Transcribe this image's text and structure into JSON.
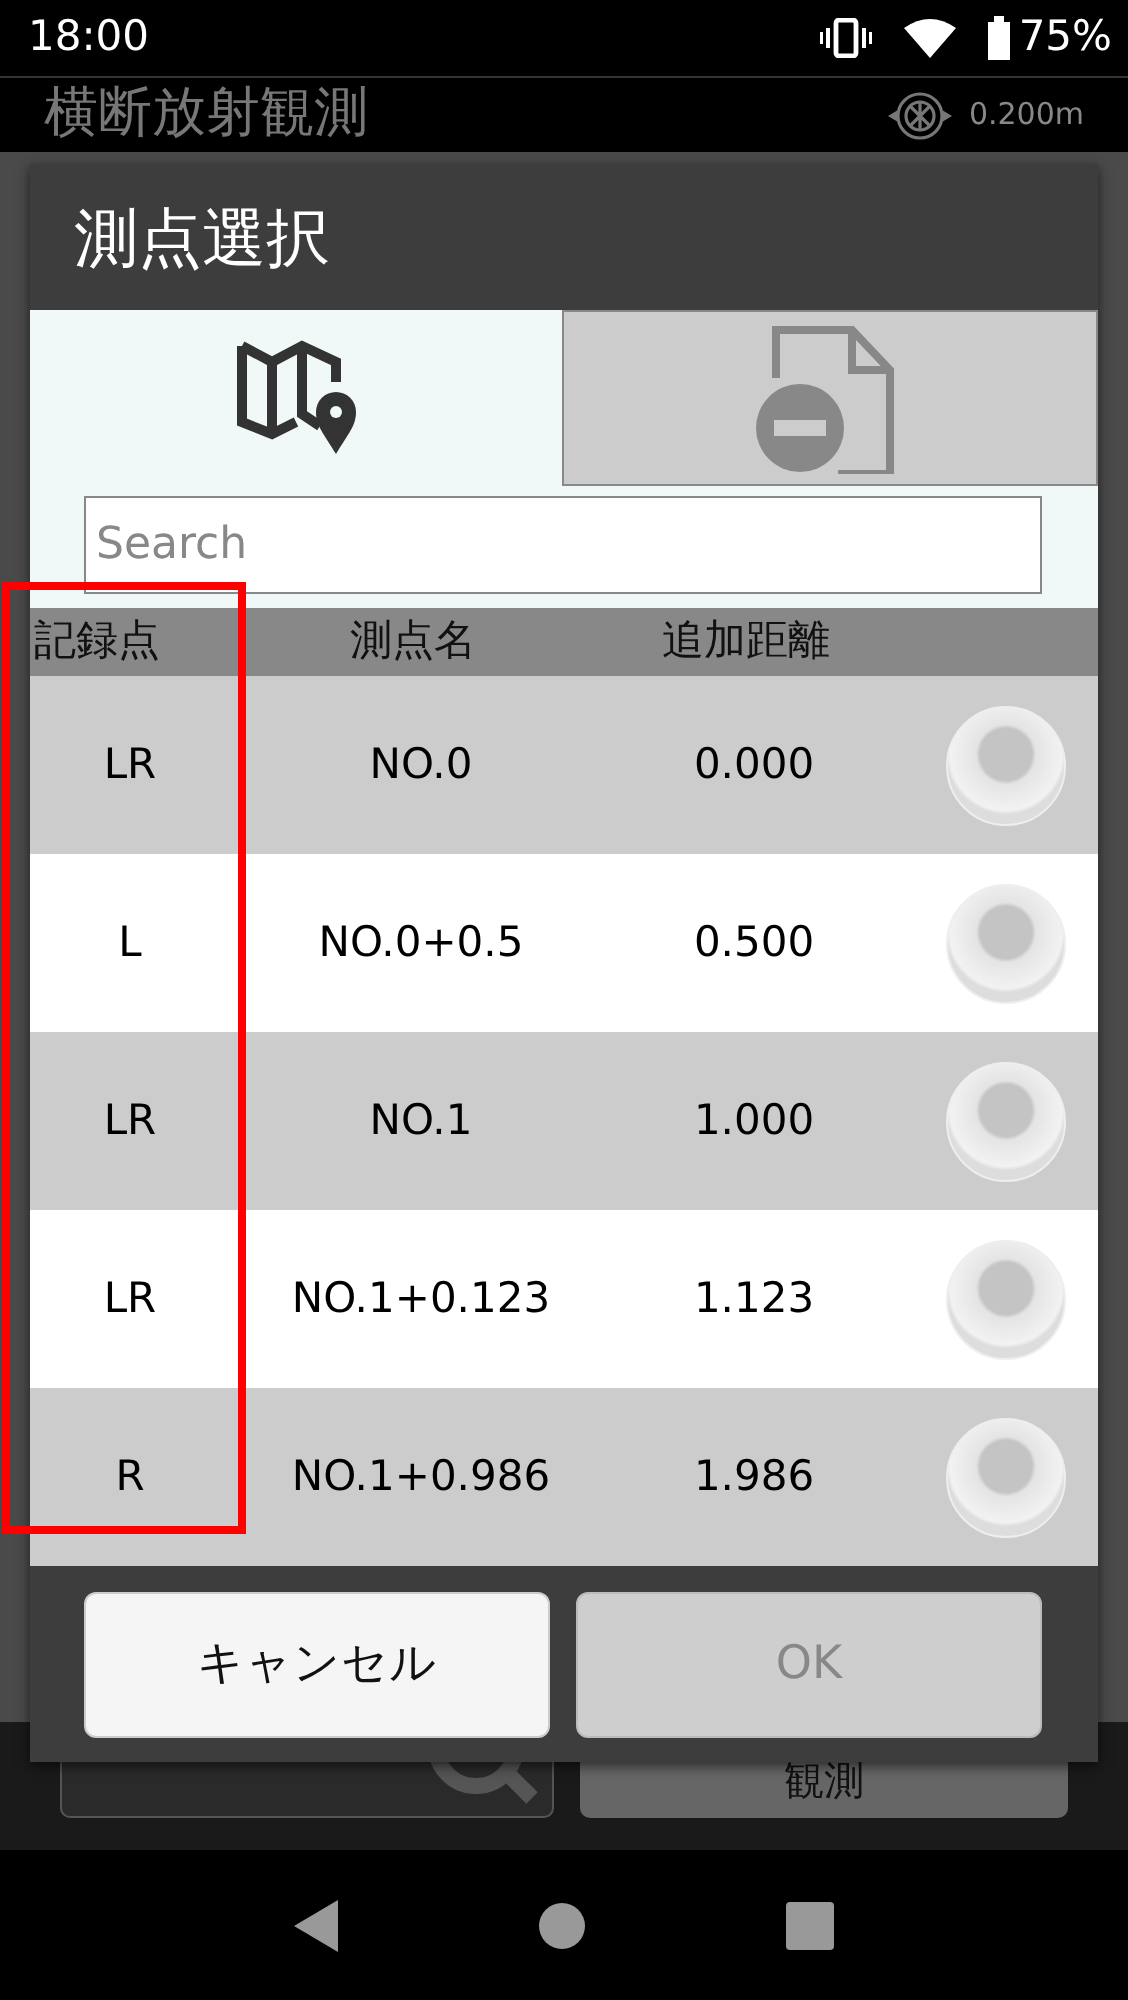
{
  "status_bar": {
    "time": "18:00",
    "battery": "75%"
  },
  "app_bar": {
    "title": "横断放射観測",
    "reading": "0.200m"
  },
  "dialog": {
    "title": "測点選択",
    "tabs": [
      {
        "kind": "map",
        "selected": true
      },
      {
        "kind": "document-remove",
        "selected": false
      }
    ],
    "search": {
      "placeholder": "Search"
    },
    "table": {
      "columns": [
        "記録点",
        "測点名",
        "追加距離"
      ],
      "rows": [
        {
          "record": "LR",
          "name": "NO.0",
          "distance": "0.000",
          "selected": false
        },
        {
          "record": "L",
          "name": "NO.0+0.5",
          "distance": "0.500",
          "selected": false
        },
        {
          "record": "LR",
          "name": "NO.1",
          "distance": "1.000",
          "selected": false
        },
        {
          "record": "LR",
          "name": "NO.1+0.123",
          "distance": "1.123",
          "selected": false
        },
        {
          "record": "R",
          "name": "NO.1+0.986",
          "distance": "1.986",
          "selected": false
        }
      ]
    },
    "buttons": [
      {
        "label": "キャンセル",
        "disabled": false
      },
      {
        "label": "OK",
        "disabled": true
      }
    ]
  },
  "background_buttons": [
    {
      "kind": "search"
    },
    {
      "kind": "text",
      "label": "観測"
    }
  ],
  "highlight": {
    "on": true
  }
}
